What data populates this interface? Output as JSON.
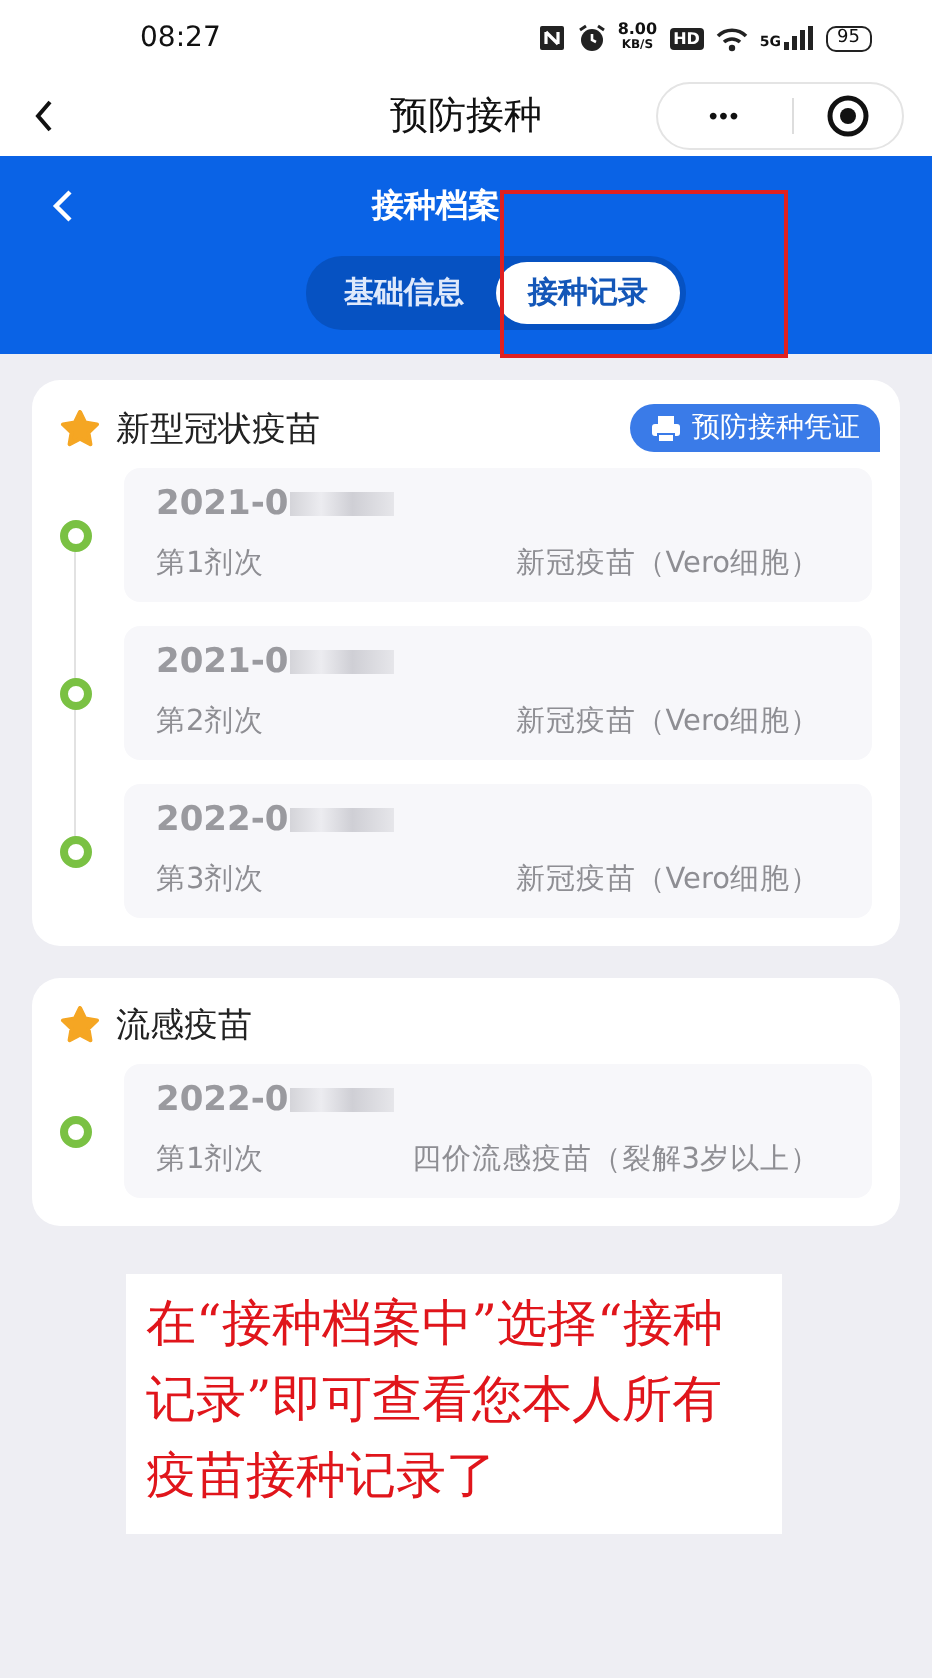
{
  "status_bar": {
    "time": "08:27",
    "speed": "8.00",
    "speed_unit": "KB/S",
    "hd": "HD",
    "network": "5G",
    "battery": "95"
  },
  "nav_bar": {
    "title": "预防接种",
    "more": "•••"
  },
  "header": {
    "title": "接种档案"
  },
  "tabs": [
    {
      "label": "基础信息",
      "selected": false
    },
    {
      "label": "接种记录",
      "selected": true
    }
  ],
  "cards": [
    {
      "title": "新型冠状疫苗",
      "action": "预防接种凭证",
      "records": [
        {
          "date": "2021-0",
          "dose": "第1剂次",
          "vaccine": "新冠疫苗（Vero细胞）"
        },
        {
          "date": "2021-0",
          "dose": "第2剂次",
          "vaccine": "新冠疫苗（Vero细胞）"
        },
        {
          "date": "2022-0",
          "dose": "第3剂次",
          "vaccine": "新冠疫苗（Vero细胞）"
        }
      ]
    },
    {
      "title": "流感疫苗",
      "records": [
        {
          "date": "2022-0",
          "dose": "第1剂次",
          "vaccine": "四价流感疫苗（裂解3岁以上）"
        }
      ]
    }
  ],
  "annotation": {
    "text": "在“接种档案中”选择“接种记录”即可查看您本人所有疫苗接种记录了"
  }
}
